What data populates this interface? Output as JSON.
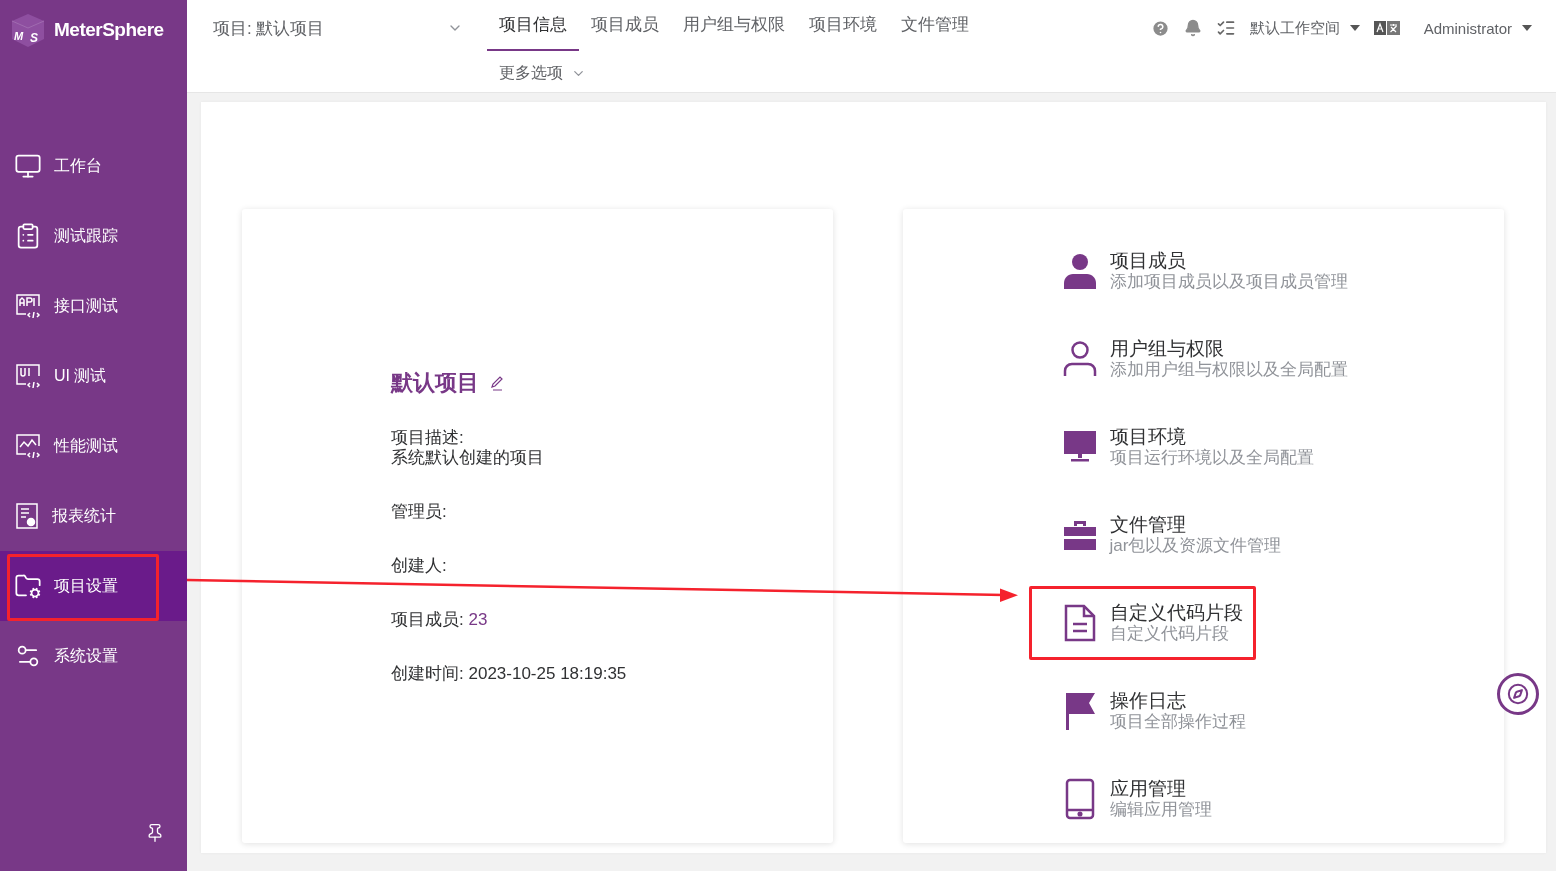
{
  "brand": {
    "name": "MeterSphere",
    "logo_letters": [
      "M",
      "S"
    ]
  },
  "sidebar": {
    "items": [
      {
        "label": "工作台",
        "selected": false,
        "annotated": false
      },
      {
        "label": "测试跟踪",
        "selected": false,
        "annotated": false
      },
      {
        "label": "接口测试",
        "selected": false,
        "annotated": false
      },
      {
        "label": "UI 测试",
        "selected": false,
        "annotated": false
      },
      {
        "label": "性能测试",
        "selected": false,
        "annotated": false
      },
      {
        "label": "报表统计",
        "selected": false,
        "annotated": false
      },
      {
        "label": "项目设置",
        "selected": true,
        "annotated": true
      },
      {
        "label": "系统设置",
        "selected": false,
        "annotated": false
      }
    ]
  },
  "header": {
    "project_selector": "项目: 默认项目",
    "tabs": [
      {
        "label": "项目信息",
        "selected": true
      },
      {
        "label": "项目成员",
        "selected": false
      },
      {
        "label": "用户组与权限",
        "selected": false
      },
      {
        "label": "项目环境",
        "selected": false
      },
      {
        "label": "文件管理",
        "selected": false
      }
    ],
    "more_menu": "更多选项",
    "workspace": "默认工作空间",
    "user": "Administrator"
  },
  "project": {
    "name": "默认项目",
    "fields": [
      {
        "kind": "stacked",
        "label": "项目描述:",
        "value": "系统默认创建的项目"
      },
      {
        "kind": "inline",
        "label": "管理员:"
      },
      {
        "kind": "inline",
        "label": "创建人:"
      },
      {
        "kind": "link",
        "label": "项目成员:",
        "value": "23"
      },
      {
        "kind": "inline",
        "label": "创建时间:",
        "value": "2023-10-25 18:19:35"
      }
    ]
  },
  "settings": {
    "items": [
      {
        "title": "项目成员",
        "description": "添加项目成员以及项目成员管理",
        "annotated": false
      },
      {
        "title": "用户组与权限",
        "description": "添加用户组与权限以及全局配置",
        "annotated": false
      },
      {
        "title": "项目环境",
        "description": "项目运行环境以及全局配置",
        "annotated": false
      },
      {
        "title": "文件管理",
        "description": "jar包以及资源文件管理",
        "annotated": false
      },
      {
        "title": "自定义代码片段",
        "description": "自定义代码片段",
        "annotated": true
      },
      {
        "title": "操作日志",
        "description": "项目全部操作过程",
        "annotated": false
      },
      {
        "title": "应用管理",
        "description": "编辑应用管理",
        "annotated": false
      }
    ]
  },
  "annotation_arrow": true
}
